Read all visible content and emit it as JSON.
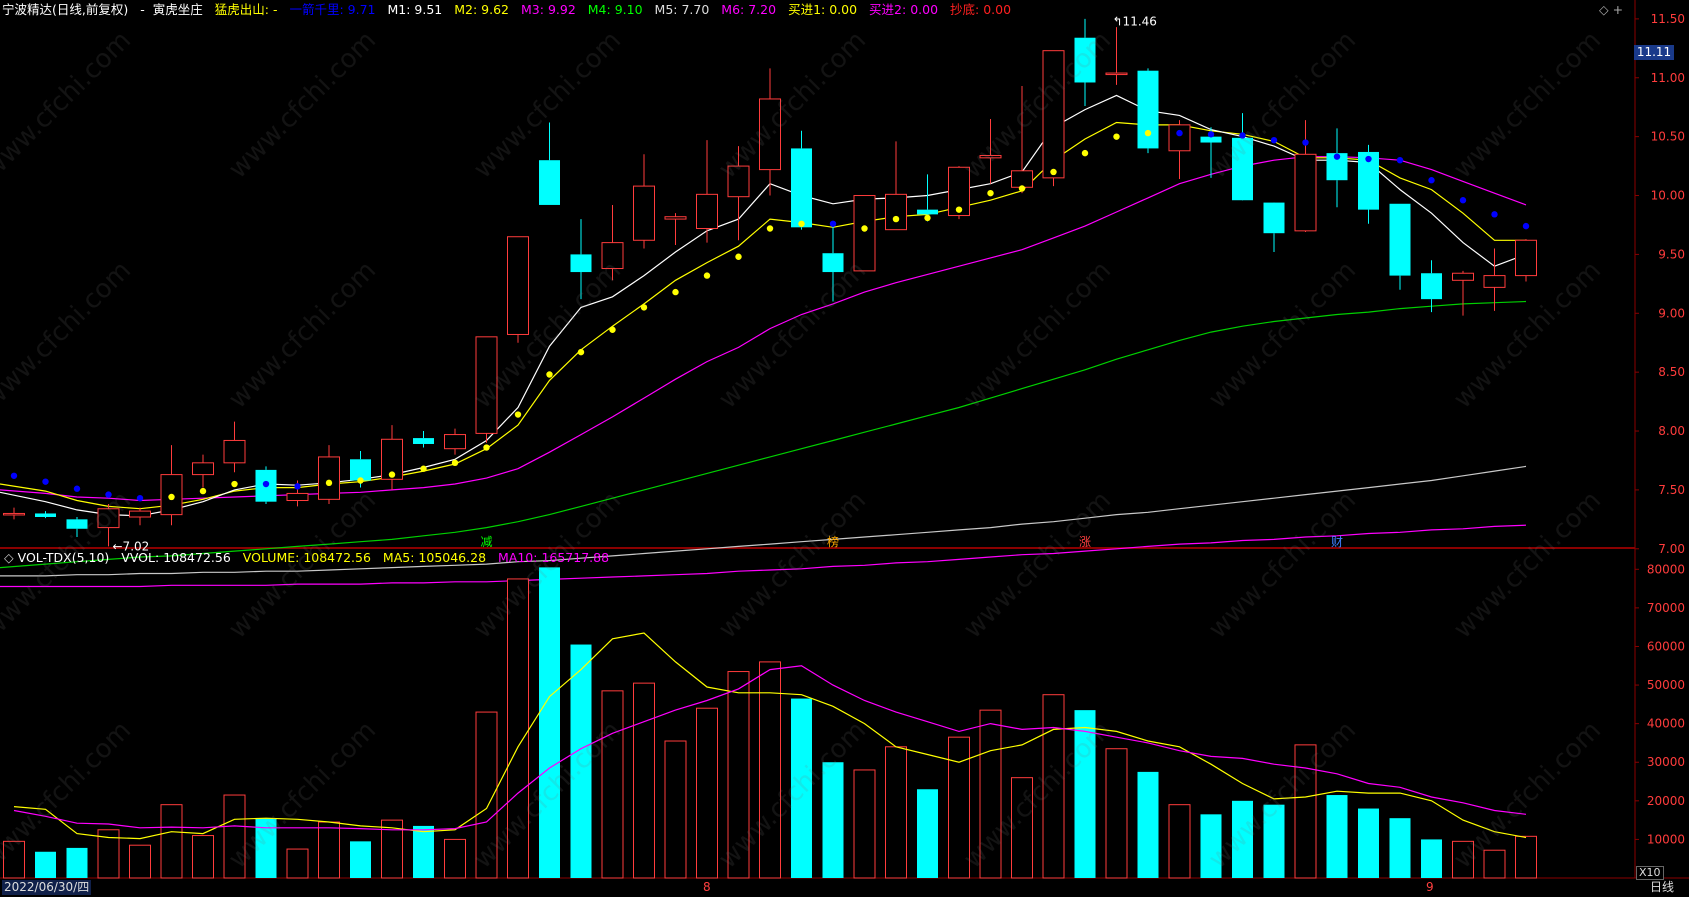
{
  "header": {
    "stock": "宁波精达",
    "period": "(日线,前复权)",
    "sep": "-",
    "indicator_name": "寅虎坐庄",
    "signal_label": "猛虎出山:",
    "signal_value": "-",
    "line_label": "一箭千里:",
    "line_value": "9.71",
    "m1_label": "M1:",
    "m1": "9.51",
    "m2_label": "M2:",
    "m2": "9.62",
    "m3_label": "M3:",
    "m3": "9.92",
    "m4_label": "M4:",
    "m4": "9.10",
    "m5_label": "M5:",
    "m5": "7.70",
    "m6_label": "M6:",
    "m6": "7.20",
    "buy1_label": "买进1:",
    "buy1": "0.00",
    "buy2_label": "买进2:",
    "buy2": "0.00",
    "bottom_label": "抄底:",
    "bottom": "0.00"
  },
  "vol_header": {
    "name": "VOL-TDX(5,10)",
    "vvol_label": "VVOL:",
    "vvol": "108472.56",
    "volume_label": "VOLUME:",
    "volume": "108472.56",
    "ma5_label": "MA5:",
    "ma5": "105046.28",
    "ma10_label": "MA10:",
    "ma10": "165717.88"
  },
  "footer": {
    "date": "2022/06/30/四",
    "month_8": "8",
    "month_9": "9",
    "period_button": "日线",
    "vol_unit": "X10"
  },
  "price_tag": "11.11",
  "colors": {
    "up": "#ff3c3c",
    "down": "#00ffff",
    "m1": "#ffffff",
    "m2": "#ffff00",
    "m3": "#ff00ff",
    "m4": "#00d000",
    "m5": "#c8c8c8",
    "m6": "#ff00ff",
    "dots_yellow": "#ffff00",
    "dots_blue": "#0000ff"
  },
  "chart_data": [
    {
      "type": "candlestick",
      "ylim": [
        6.65,
        11.55
      ],
      "y_ticks": [
        7.0,
        7.5,
        8.0,
        8.5,
        9.0,
        9.5,
        10.0,
        10.5,
        11.0,
        11.5
      ],
      "annotations": {
        "high": "11.46",
        "low": "7.02"
      },
      "events": [
        "减",
        "榜",
        "涨",
        "财"
      ],
      "ohlc": [
        [
          7.3,
          7.35,
          7.25,
          7.3
        ],
        [
          7.3,
          7.32,
          7.26,
          7.27
        ],
        [
          7.25,
          7.27,
          7.1,
          7.17
        ],
        [
          7.18,
          7.38,
          7.02,
          7.34
        ],
        [
          7.27,
          7.35,
          7.2,
          7.32
        ],
        [
          7.29,
          7.88,
          7.2,
          7.63
        ],
        [
          7.63,
          7.8,
          7.52,
          7.73
        ],
        [
          7.73,
          8.08,
          7.65,
          7.92
        ],
        [
          7.67,
          7.7,
          7.38,
          7.4
        ],
        [
          7.41,
          7.58,
          7.36,
          7.47
        ],
        [
          7.42,
          7.88,
          7.38,
          7.78
        ],
        [
          7.76,
          7.83,
          7.52,
          7.58
        ],
        [
          7.59,
          8.05,
          7.5,
          7.93
        ],
        [
          7.94,
          8.0,
          7.86,
          7.89
        ],
        [
          7.85,
          8.02,
          7.8,
          7.97
        ],
        [
          7.98,
          8.8,
          7.9,
          8.8
        ],
        [
          8.82,
          9.65,
          8.75,
          9.65
        ],
        [
          10.3,
          10.62,
          9.92,
          9.92
        ],
        [
          9.5,
          9.8,
          9.12,
          9.35
        ],
        [
          9.38,
          9.92,
          9.28,
          9.6
        ],
        [
          9.62,
          10.35,
          9.55,
          10.08
        ],
        [
          9.8,
          9.85,
          9.58,
          9.82
        ],
        [
          9.72,
          10.47,
          9.6,
          10.01
        ],
        [
          9.99,
          10.42,
          9.62,
          10.25
        ],
        [
          10.22,
          11.08,
          10.0,
          10.82
        ],
        [
          10.4,
          10.55,
          9.71,
          9.73
        ],
        [
          9.51,
          9.78,
          9.1,
          9.35
        ],
        [
          9.36,
          10.0,
          9.36,
          10.0
        ],
        [
          9.71,
          10.46,
          9.71,
          10.01
        ],
        [
          9.88,
          10.18,
          9.78,
          9.84
        ],
        [
          9.83,
          10.25,
          9.8,
          10.24
        ],
        [
          10.32,
          10.65,
          10.1,
          10.34
        ],
        [
          10.07,
          10.93,
          10.02,
          10.21
        ],
        [
          10.15,
          11.23,
          10.08,
          11.23
        ],
        [
          11.34,
          11.5,
          10.76,
          10.96
        ],
        [
          11.04,
          11.43,
          10.94,
          11.04
        ],
        [
          11.06,
          11.08,
          10.36,
          10.4
        ],
        [
          10.38,
          10.64,
          10.14,
          10.6
        ],
        [
          10.5,
          10.58,
          10.15,
          10.45
        ],
        [
          10.49,
          10.7,
          10.0,
          9.96
        ],
        [
          9.94,
          9.92,
          9.52,
          9.68
        ],
        [
          9.7,
          10.64,
          9.69,
          10.35
        ],
        [
          10.36,
          10.57,
          9.9,
          10.13
        ],
        [
          10.37,
          10.43,
          9.76,
          9.88
        ],
        [
          9.93,
          9.93,
          9.2,
          9.32
        ],
        [
          9.34,
          9.45,
          9.01,
          9.12
        ],
        [
          9.28,
          9.36,
          8.98,
          9.34
        ],
        [
          9.22,
          9.55,
          9.02,
          9.32
        ],
        [
          9.32,
          9.63,
          9.27,
          9.62
        ]
      ],
      "series": [
        {
          "name": "M1",
          "values": [
            7.48,
            7.4,
            7.33,
            7.29,
            7.28,
            7.33,
            7.4,
            7.5,
            7.55,
            7.54,
            7.56,
            7.59,
            7.63,
            7.69,
            7.76,
            7.92,
            8.2,
            8.72,
            9.05,
            9.14,
            9.32,
            9.52,
            9.7,
            9.8,
            10.1,
            10.0,
            9.93,
            9.97,
            9.98,
            10.0,
            10.05,
            10.1,
            10.2,
            10.58,
            10.73,
            10.85,
            10.72,
            10.68,
            10.56,
            10.5,
            10.42,
            10.3,
            10.3,
            10.28,
            10.05,
            9.85,
            9.6,
            9.4,
            9.5
          ]
        },
        {
          "name": "M2",
          "values": [
            7.55,
            7.49,
            7.41,
            7.36,
            7.34,
            7.37,
            7.42,
            7.49,
            7.52,
            7.52,
            7.55,
            7.57,
            7.61,
            7.66,
            7.72,
            7.85,
            8.05,
            8.43,
            8.69,
            8.89,
            9.08,
            9.28,
            9.43,
            9.57,
            9.8,
            9.77,
            9.73,
            9.78,
            9.82,
            9.84,
            9.9,
            9.96,
            10.04,
            10.3,
            10.48,
            10.62,
            10.6,
            10.6,
            10.55,
            10.52,
            10.46,
            10.32,
            10.32,
            10.3,
            10.15,
            10.05,
            9.85,
            9.62,
            9.62
          ]
        },
        {
          "name": "M3",
          "values": [
            7.5,
            7.47,
            7.44,
            7.43,
            7.41,
            7.42,
            7.43,
            7.44,
            7.45,
            7.46,
            7.47,
            7.48,
            7.5,
            7.52,
            7.55,
            7.6,
            7.68,
            7.82,
            7.97,
            8.12,
            8.28,
            8.44,
            8.59,
            8.71,
            8.87,
            8.99,
            9.08,
            9.18,
            9.26,
            9.33,
            9.4,
            9.47,
            9.54,
            9.64,
            9.74,
            9.86,
            9.98,
            10.1,
            10.18,
            10.25,
            10.3,
            10.33,
            10.33,
            10.32,
            10.3,
            10.22,
            10.12,
            10.02,
            9.92
          ]
        },
        {
          "name": "M4",
          "values": [
            6.84,
            6.87,
            6.89,
            6.91,
            6.93,
            6.94,
            6.96,
            6.98,
            7.0,
            7.02,
            7.04,
            7.06,
            7.08,
            7.11,
            7.14,
            7.18,
            7.23,
            7.29,
            7.36,
            7.43,
            7.5,
            7.57,
            7.64,
            7.71,
            7.78,
            7.85,
            7.92,
            7.99,
            8.06,
            8.13,
            8.2,
            8.28,
            8.36,
            8.44,
            8.52,
            8.61,
            8.69,
            8.77,
            8.84,
            8.89,
            8.93,
            8.96,
            8.99,
            9.01,
            9.04,
            9.06,
            9.08,
            9.09,
            9.1
          ]
        },
        {
          "name": "M5",
          "values": [
            6.77,
            6.77,
            6.78,
            6.78,
            6.79,
            6.79,
            6.8,
            6.8,
            6.81,
            6.81,
            6.82,
            6.83,
            6.84,
            6.85,
            6.86,
            6.87,
            6.89,
            6.9,
            6.92,
            6.94,
            6.96,
            6.98,
            7.0,
            7.02,
            7.04,
            7.06,
            7.08,
            7.1,
            7.12,
            7.14,
            7.16,
            7.18,
            7.21,
            7.23,
            7.26,
            7.29,
            7.31,
            7.34,
            7.37,
            7.4,
            7.43,
            7.46,
            7.49,
            7.52,
            7.55,
            7.58,
            7.62,
            7.66,
            7.7
          ]
        },
        {
          "name": "M6",
          "values": [
            6.68,
            6.68,
            6.68,
            6.68,
            6.68,
            6.69,
            6.69,
            6.69,
            6.69,
            6.7,
            6.7,
            6.7,
            6.71,
            6.71,
            6.72,
            6.72,
            6.73,
            6.74,
            6.75,
            6.76,
            6.77,
            6.78,
            6.79,
            6.81,
            6.82,
            6.83,
            6.85,
            6.86,
            6.88,
            6.89,
            6.91,
            6.93,
            6.95,
            6.96,
            6.98,
            7.0,
            7.02,
            7.04,
            7.05,
            7.07,
            7.08,
            7.1,
            7.11,
            7.13,
            7.14,
            7.16,
            7.17,
            7.19,
            7.2
          ]
        }
      ],
      "dots": [
        {
          "c": "b",
          "v": 7.62
        },
        {
          "c": "b",
          "v": 7.57
        },
        {
          "c": "b",
          "v": 7.51
        },
        {
          "c": "b",
          "v": 7.46
        },
        {
          "c": "b",
          "v": 7.43
        },
        {
          "c": "y",
          "v": 7.44
        },
        {
          "c": "y",
          "v": 7.49
        },
        {
          "c": "y",
          "v": 7.55
        },
        {
          "c": "b",
          "v": 7.55
        },
        {
          "c": "b",
          "v": 7.53
        },
        {
          "c": "y",
          "v": 7.56
        },
        {
          "c": "y",
          "v": 7.58
        },
        {
          "c": "y",
          "v": 7.63
        },
        {
          "c": "y",
          "v": 7.68
        },
        {
          "c": "y",
          "v": 7.73
        },
        {
          "c": "y",
          "v": 7.86
        },
        {
          "c": "y",
          "v": 8.14
        },
        {
          "c": "y",
          "v": 8.48
        },
        {
          "c": "y",
          "v": 8.67
        },
        {
          "c": "y",
          "v": 8.86
        },
        {
          "c": "y",
          "v": 9.05
        },
        {
          "c": "y",
          "v": 9.18
        },
        {
          "c": "y",
          "v": 9.32
        },
        {
          "c": "y",
          "v": 9.48
        },
        {
          "c": "y",
          "v": 9.72
        },
        {
          "c": "y",
          "v": 9.76
        },
        {
          "c": "b",
          "v": 9.76
        },
        {
          "c": "y",
          "v": 9.72
        },
        {
          "c": "y",
          "v": 9.8
        },
        {
          "c": "y",
          "v": 9.81
        },
        {
          "c": "y",
          "v": 9.88
        },
        {
          "c": "y",
          "v": 10.02
        },
        {
          "c": "y",
          "v": 10.06
        },
        {
          "c": "y",
          "v": 10.2
        },
        {
          "c": "y",
          "v": 10.36
        },
        {
          "c": "y",
          "v": 10.5
        },
        {
          "c": "y",
          "v": 10.53
        },
        {
          "c": "b",
          "v": 10.53
        },
        {
          "c": "b",
          "v": 10.52
        },
        {
          "c": "b",
          "v": 10.51
        },
        {
          "c": "b",
          "v": 10.47
        },
        {
          "c": "b",
          "v": 10.45
        },
        {
          "c": "b",
          "v": 10.33
        },
        {
          "c": "b",
          "v": 10.31
        },
        {
          "c": "b",
          "v": 10.3
        },
        {
          "c": "b",
          "v": 10.13
        },
        {
          "c": "b",
          "v": 9.96
        },
        {
          "c": "b",
          "v": 9.84
        },
        {
          "c": "b",
          "v": 9.74
        }
      ]
    },
    {
      "type": "bar",
      "ylim": [
        0,
        85000
      ],
      "y_ticks": [
        10000,
        20000,
        30000,
        40000,
        50000,
        60000,
        70000,
        80000
      ],
      "values": [
        9500,
        6800,
        7800,
        12500,
        8500,
        19000,
        11000,
        21500,
        15500,
        7500,
        14500,
        9500,
        15000,
        13500,
        10000,
        43000,
        77500,
        80500,
        60500,
        48500,
        50500,
        35500,
        44000,
        53500,
        56000,
        46500,
        30000,
        28000,
        34000,
        23000,
        36500,
        43500,
        26000,
        47500,
        43500,
        33500,
        27500,
        19000,
        16500,
        20000,
        19000,
        34500,
        21500,
        18000,
        15500,
        10000,
        9500,
        7200,
        10800
      ],
      "series": [
        {
          "name": "MA5",
          "values": [
            18500,
            17800,
            11500,
            10500,
            10200,
            12000,
            11500,
            15200,
            15500,
            15200,
            14500,
            13500,
            13000,
            12000,
            12500,
            18000,
            34000,
            47000,
            54000,
            62000,
            63500,
            56000,
            49500,
            48000,
            48000,
            47500,
            44500,
            40000,
            34000,
            32000,
            30000,
            33000,
            34500,
            38500,
            39000,
            38000,
            35500,
            34000,
            29500,
            24500,
            20500,
            21000,
            22500,
            22000,
            22000,
            20000,
            15000,
            12000,
            10500
          ]
        },
        {
          "name": "MA10",
          "values": [
            17500,
            16000,
            14200,
            14000,
            13000,
            13200,
            13000,
            13500,
            13000,
            13000,
            13000,
            12800,
            12500,
            12500,
            12800,
            14500,
            22000,
            28500,
            33500,
            37500,
            40500,
            43500,
            46000,
            49000,
            54000,
            55000,
            50000,
            46000,
            43000,
            40500,
            38000,
            40000,
            38500,
            39000,
            38000,
            36500,
            35000,
            33000,
            31500,
            31000,
            29500,
            28500,
            27000,
            24500,
            23500,
            21000,
            19500,
            17500,
            16500
          ]
        }
      ]
    }
  ]
}
